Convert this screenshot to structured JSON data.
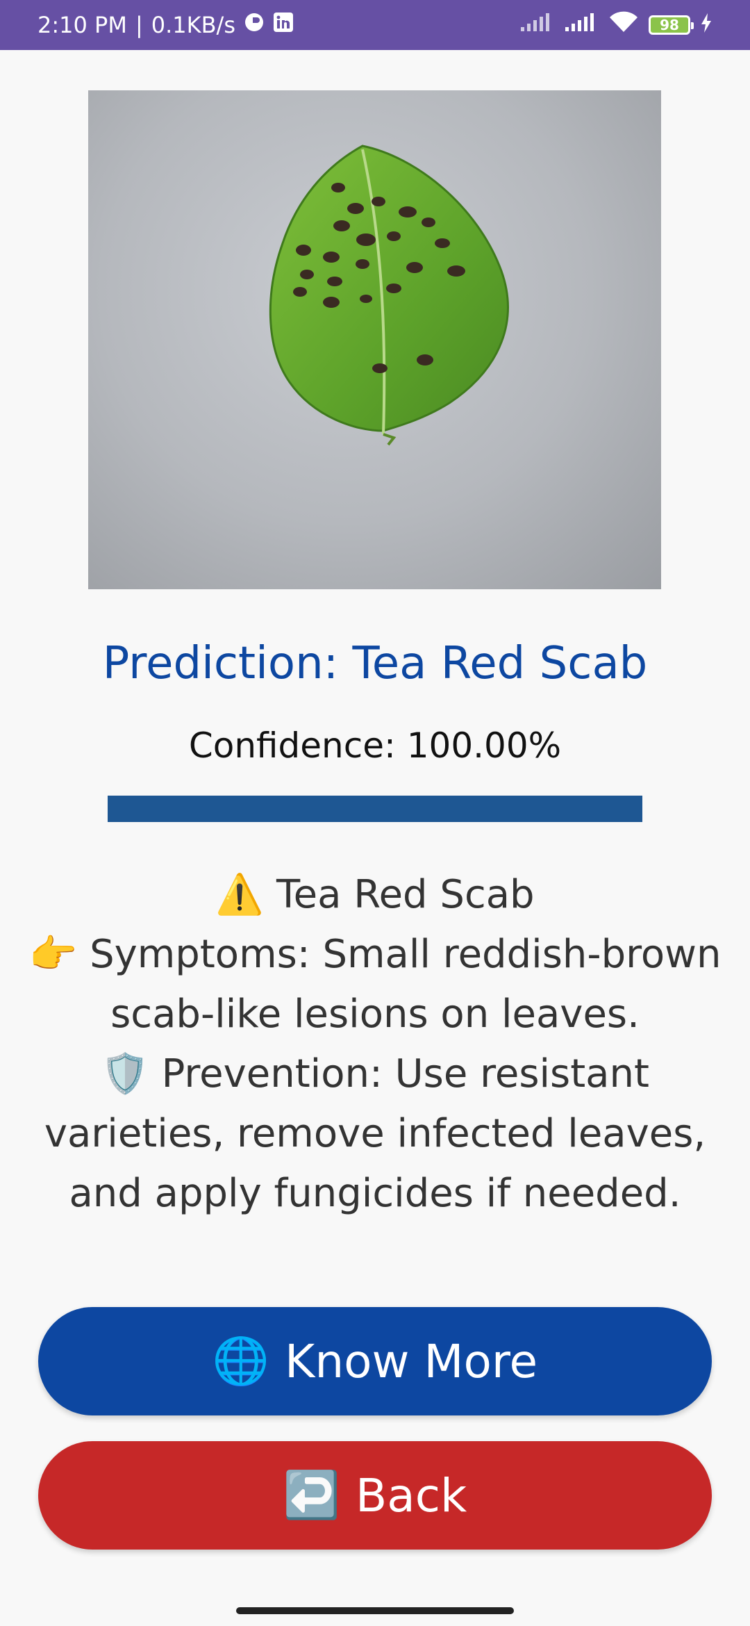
{
  "status_bar": {
    "time": "2:10 PM",
    "separator": "|",
    "speed": "0.1KB/s",
    "battery": "98",
    "icons": [
      "clock-app-icon",
      "linkedin-icon",
      "signal-icon",
      "signal-icon",
      "wifi-icon",
      "battery-icon",
      "charging-bolt-icon"
    ]
  },
  "result": {
    "prediction": "Prediction: Tea Red Scab",
    "confidence": "Confidence: 100.00%",
    "confidence_value": 1.0
  },
  "info": {
    "warning_icon": "⚠️",
    "disease": "Tea Red Scab",
    "symptoms_icon": "👉",
    "symptoms": "Symptoms: Small reddish-brown scab-like lesions on leaves.",
    "prevention_icon": "🛡️",
    "prevention": "Prevention: Use resistant varieties, remove infected leaves, and apply fungicides if needed."
  },
  "buttons": {
    "know_more_icon": "🌐",
    "know_more": "Know More",
    "back_icon": "↩️",
    "back": "Back"
  },
  "colors": {
    "status_bar": "#6650a4",
    "title": "#0d47a1",
    "progress": "#1e5793",
    "know_more_button": "#0d47a1",
    "back_button": "#c62828"
  }
}
